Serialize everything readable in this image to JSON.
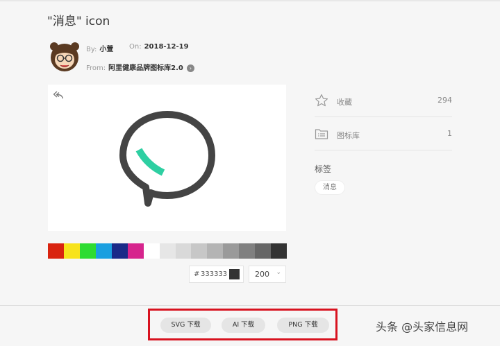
{
  "header": {
    "title": "\"消息\" icon"
  },
  "meta": {
    "by_label": "By:",
    "author": "小萱",
    "on_label": "On:",
    "date": "2018-12-19",
    "from_label": "From:",
    "library": "阿里健康品牌图标库2.0",
    "chevron": "›"
  },
  "preview": {
    "back_icon": "undo-arrow-icon",
    "main_icon": "message-bubble-icon"
  },
  "palette": {
    "swatches": [
      "#d9230f",
      "#f7e31c",
      "#2ddc32",
      "#1a9fe0",
      "#1a2a88",
      "#d6248d",
      "#ffffff",
      "#e6e6e6",
      "#d9d9d9",
      "#c7c7c7",
      "#b4b4b4",
      "#9a9a9a",
      "#808080",
      "#666666",
      "#333333"
    ]
  },
  "color_input": {
    "hash": "#",
    "value": "333333",
    "swatch_color": "#333333"
  },
  "size_select": {
    "value": "200",
    "arrow": "⌄"
  },
  "stats": {
    "favorites_label": "收藏",
    "favorites_count": "294",
    "library_label": "图标库",
    "library_count": "1"
  },
  "tags": {
    "heading": "标签",
    "items": [
      "消息"
    ]
  },
  "downloads": {
    "svg": "SVG 下载",
    "ai": "AI 下载",
    "png": "PNG 下载"
  },
  "watermark": "头条 @头家信息网",
  "colors": {
    "icon_stroke": "#444444",
    "icon_accent": "#2ecfa2",
    "highlight_border": "#d8121f"
  }
}
